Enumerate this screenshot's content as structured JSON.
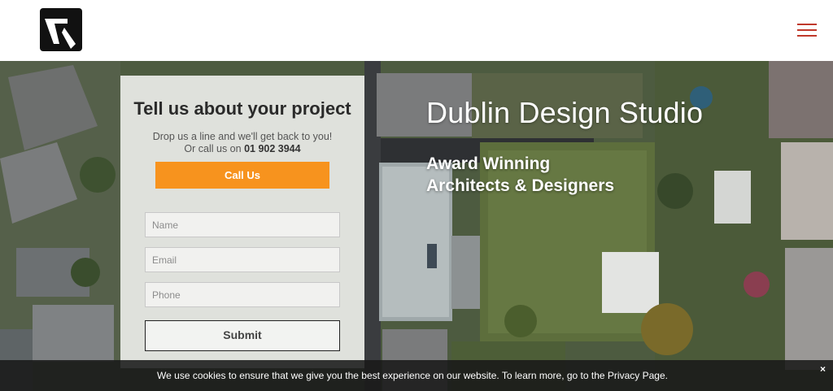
{
  "header": {
    "logo_icon": "studio-logo-icon",
    "menu_icon": "hamburger-menu-icon",
    "menu_color": "#c0392b"
  },
  "form": {
    "title": "Tell us about your project",
    "subtitle": "Drop us a line and we'll get back to you!",
    "call_prefix": "Or call us on",
    "phone": "01 902 3944",
    "call_button": "Call Us",
    "name_placeholder": "Name",
    "email_placeholder": "Email",
    "phone_placeholder": "Phone",
    "submit_button": "Submit",
    "accent_color": "#f7931e"
  },
  "hero": {
    "title": "Dublin Design Studio",
    "tagline_line1": "Award Winning",
    "tagline_line2": "Architects & Designers"
  },
  "cookie": {
    "text": "We use cookies to ensure that we give you the best experience on our website. To learn more, go to the Privacy Page.",
    "close_label": "×"
  }
}
